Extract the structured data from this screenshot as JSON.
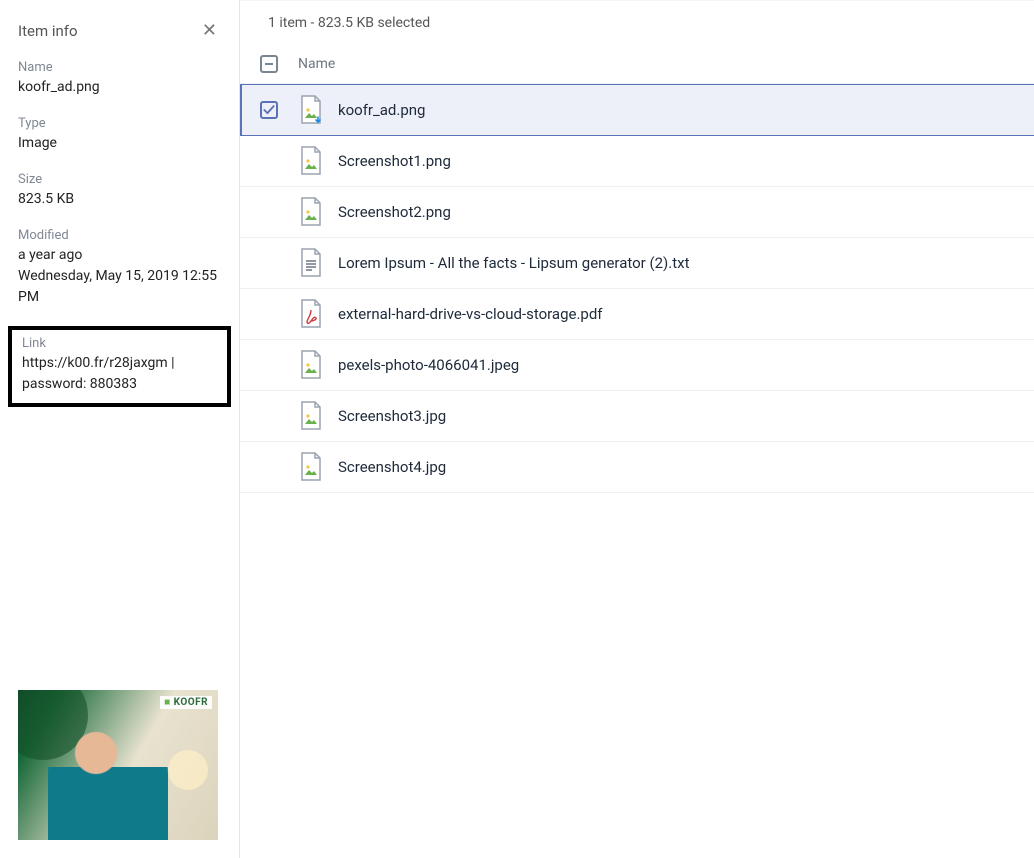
{
  "sidebar": {
    "title": "Item info",
    "fields": {
      "name_label": "Name",
      "name_value": "koofr_ad.png",
      "type_label": "Type",
      "type_value": "Image",
      "size_label": "Size",
      "size_value": "823.5 KB",
      "modified_label": "Modified",
      "modified_relative": "a year ago",
      "modified_absolute": "Wednesday, May 15, 2019 12:55 PM",
      "link_label": "Link",
      "link_value": "https://k00.fr/r28jaxgm | password: 880383"
    },
    "preview_brand": "KOOFR"
  },
  "main": {
    "selection_summary": "1 item - 823.5 KB selected",
    "columns": {
      "name": "Name"
    },
    "files": [
      {
        "name": "koofr_ad.png",
        "kind": "image",
        "selected": true
      },
      {
        "name": "Screenshot1.png",
        "kind": "image",
        "selected": false
      },
      {
        "name": "Screenshot2.png",
        "kind": "image",
        "selected": false
      },
      {
        "name": "Lorem Ipsum - All the facts - Lipsum generator (2).txt",
        "kind": "text",
        "selected": false
      },
      {
        "name": "external-hard-drive-vs-cloud-storage.pdf",
        "kind": "pdf",
        "selected": false
      },
      {
        "name": "pexels-photo-4066041.jpeg",
        "kind": "image",
        "selected": false
      },
      {
        "name": "Screenshot3.jpg",
        "kind": "image",
        "selected": false
      },
      {
        "name": "Screenshot4.jpg",
        "kind": "image",
        "selected": false
      }
    ]
  }
}
